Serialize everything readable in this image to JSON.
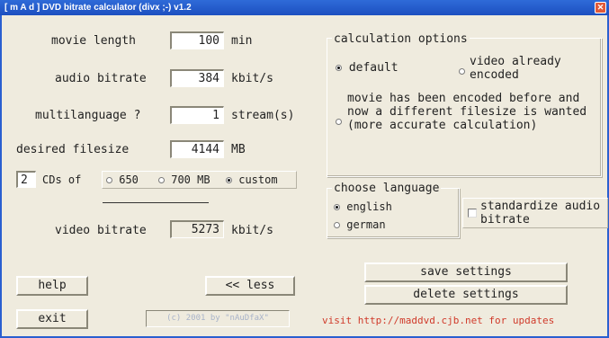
{
  "window": {
    "title": "[ m A d ] DVD bitrate calculator (divx ;-)  v1.2",
    "close_glyph": "✕"
  },
  "fields": {
    "movie_length": {
      "label": "movie length",
      "value": "100",
      "unit": "min"
    },
    "audio_bitrate": {
      "label": "audio bitrate",
      "value": "384",
      "unit": "kbit/s"
    },
    "multilanguage": {
      "label": "multilanguage ?",
      "value": "1",
      "unit": "stream(s)"
    },
    "desired_filesize": {
      "label": "desired filesize",
      "value": "4144",
      "unit": "MB"
    },
    "cd_count": {
      "value": "2",
      "label": "CDs of"
    },
    "video_bitrate": {
      "label": "video bitrate",
      "value": "5273",
      "unit": "kbit/s"
    }
  },
  "cd_sizes": {
    "options": [
      "650",
      "700 MB",
      "custom"
    ],
    "selected": "custom"
  },
  "calculation_options": {
    "legend": "calculation options",
    "default_label": "default",
    "already_encoded_label": "video already encoded",
    "reencode_label": "movie has been encoded before and now a different filesize is wanted (more accurate calculation)",
    "selected": "default"
  },
  "language": {
    "legend": "choose language",
    "english_label": "english",
    "german_label": "german",
    "selected": "english"
  },
  "standardize": {
    "label": "standardize audio bitrate",
    "checked": false
  },
  "buttons": {
    "help": "help",
    "less": "<< less",
    "exit": "exit",
    "save": "save settings",
    "delete": "delete settings"
  },
  "footer": {
    "copyright": "(c) 2001 by \"nAuDfaX\"",
    "visit": "visit http://maddvd.cjb.net for updates"
  },
  "colors": {
    "titlebar": "#1c4fc0",
    "background": "#efebde",
    "visit_text": "#d03a2a",
    "copyright_text": "#a8b3c9"
  }
}
